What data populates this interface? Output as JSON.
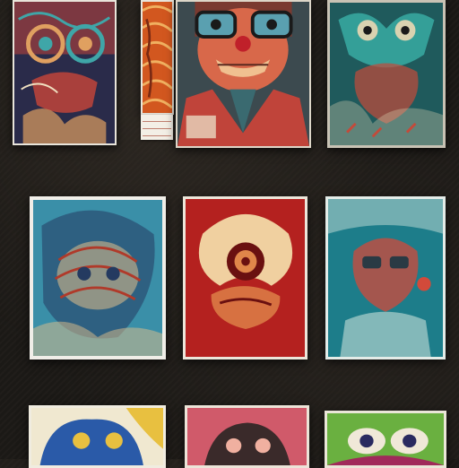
{
  "gallery": {
    "background": "#1c1916",
    "captions": [
      "",
      "",
      "",
      "",
      "",
      ""
    ],
    "artworks": [
      {
        "icon": "masked-figure-art",
        "palette": [
          "#2a2b4a",
          "#e0a060",
          "#3fa6a8",
          "#c0443a"
        ]
      },
      {
        "icon": "orange-swirl-art",
        "palette": [
          "#d2571f",
          "#f0b060",
          "#7a2a14"
        ]
      },
      {
        "icon": "goggled-face-portrait",
        "palette": [
          "#3c4a4f",
          "#d8684a",
          "#5aa0b0",
          "#f0c090"
        ]
      },
      {
        "icon": "teal-creature-art",
        "palette": [
          "#1f5a5c",
          "#d9d2b0",
          "#c34a3a",
          "#3ab0a8"
        ]
      },
      {
        "icon": "blue-swirl-face-art",
        "palette": [
          "#3a8fa8",
          "#e2c08a",
          "#b03a2a",
          "#243a60"
        ]
      },
      {
        "icon": "red-spiral-face-art",
        "palette": [
          "#b4211f",
          "#f0d0a0",
          "#6a1010",
          "#e0864a"
        ]
      },
      {
        "icon": "teal-figure-art",
        "palette": [
          "#1d7d8a",
          "#c8e0d8",
          "#d24a3a",
          "#2a3a44"
        ]
      },
      {
        "icon": "yellow-blue-face-art",
        "palette": [
          "#e8c040",
          "#2a5aa8",
          "#f0e8d0"
        ]
      },
      {
        "icon": "pink-face-art",
        "palette": [
          "#d05a6a",
          "#3a2a2a",
          "#f0b0a0"
        ]
      },
      {
        "icon": "green-eyes-art",
        "palette": [
          "#6ab040",
          "#f0e8d8",
          "#a02a5a",
          "#2a2a60"
        ]
      }
    ]
  }
}
